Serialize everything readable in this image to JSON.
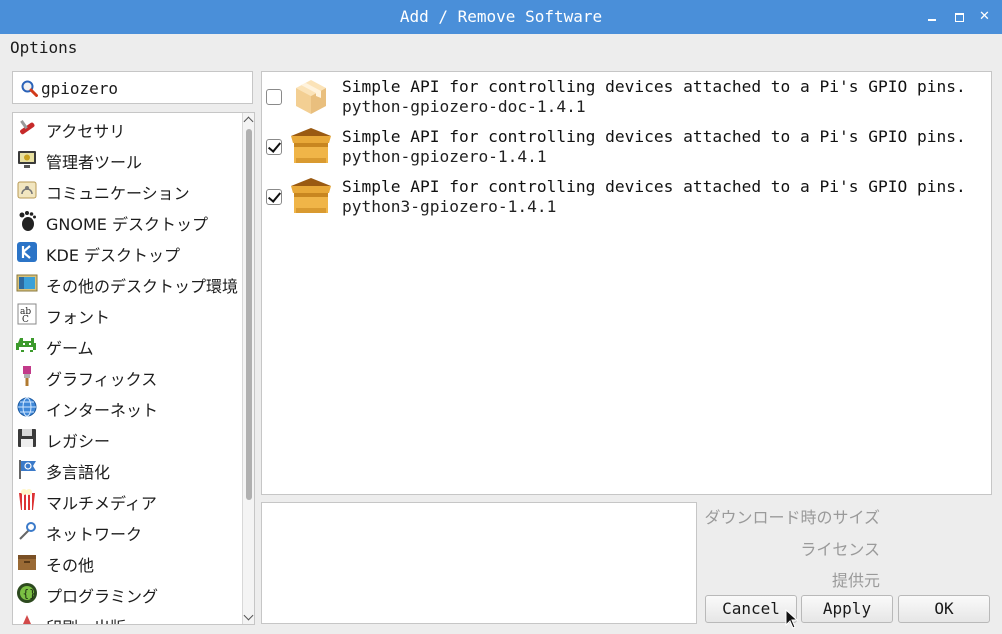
{
  "window": {
    "title": "Add / Remove Software",
    "controls": [
      "minimize-icon",
      "maximize-icon",
      "close-icon"
    ]
  },
  "menu": {
    "options": "Options"
  },
  "search": {
    "value": "gpiozero",
    "icon": "search-icon"
  },
  "categories": [
    {
      "label": "アクセサリ",
      "icon": "accessories-icon"
    },
    {
      "label": "管理者ツール",
      "icon": "admin-tools-icon"
    },
    {
      "label": "コミュニケーション",
      "icon": "communication-icon"
    },
    {
      "label": "GNOME デスクトップ",
      "icon": "gnome-icon"
    },
    {
      "label": "KDE デスクトップ",
      "icon": "kde-icon"
    },
    {
      "label": "その他のデスクトップ環境",
      "icon": "desktop-icon"
    },
    {
      "label": "フォント",
      "icon": "font-icon"
    },
    {
      "label": "ゲーム",
      "icon": "game-icon"
    },
    {
      "label": "グラフィックス",
      "icon": "graphics-icon"
    },
    {
      "label": "インターネット",
      "icon": "internet-icon"
    },
    {
      "label": "レガシー",
      "icon": "legacy-icon"
    },
    {
      "label": "多言語化",
      "icon": "localization-icon"
    },
    {
      "label": "マルチメディア",
      "icon": "multimedia-icon"
    },
    {
      "label": "ネットワーク",
      "icon": "network-icon"
    },
    {
      "label": "その他",
      "icon": "other-icon"
    },
    {
      "label": "プログラミング",
      "icon": "programming-icon"
    },
    {
      "label": "印刷・出版",
      "icon": "publishing-icon"
    }
  ],
  "packages": [
    {
      "description": "Simple API for controlling devices attached to a Pi's GPIO pins.",
      "name": "python-gpiozero-doc-1.4.1",
      "checked": false,
      "icon": "package-icon"
    },
    {
      "description": "Simple API for controlling devices attached to a Pi's GPIO pins.",
      "name": "python-gpiozero-1.4.1",
      "checked": true,
      "icon": "package-icon"
    },
    {
      "description": "Simple API for controlling devices attached to a Pi's GPIO pins.",
      "name": "python3-gpiozero-1.4.1",
      "checked": true,
      "icon": "package-icon"
    }
  ],
  "details": {
    "download_size_label": "ダウンロード時のサイズ",
    "license_label": "ライセンス",
    "provider_label": "提供元"
  },
  "buttons": {
    "cancel": "Cancel",
    "apply": "Apply",
    "ok": "OK"
  }
}
